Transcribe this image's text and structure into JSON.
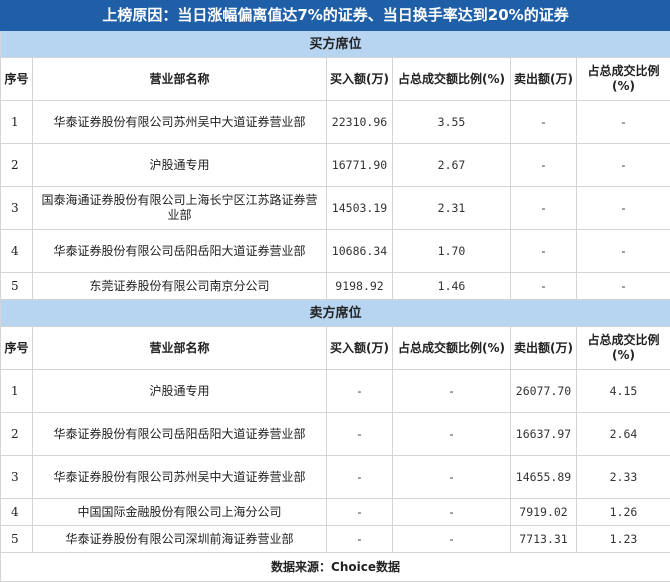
{
  "title": "上榜原因：当日涨幅偏离值达7%的证券、当日换手率达到20%的证券",
  "headers": [
    "序号",
    "营业部名称",
    "买入额(万)",
    "占总成交额比例(%)",
    "卖出额(万)",
    "占总成交比例(%)"
  ],
  "buy": {
    "section": "买方席位",
    "rows": [
      [
        "1",
        "华泰证券股份有限公司苏州吴中大道证券营业部",
        "22310.96",
        "3.55",
        "-",
        "-"
      ],
      [
        "2",
        "沪股通专用",
        "16771.90",
        "2.67",
        "-",
        "-"
      ],
      [
        "3",
        "国泰海通证券股份有限公司上海长宁区江苏路证券营业部",
        "14503.19",
        "2.31",
        "-",
        "-"
      ],
      [
        "4",
        "华泰证券股份有限公司岳阳岳阳大道证券营业部",
        "10686.34",
        "1.70",
        "-",
        "-"
      ],
      [
        "5",
        "东莞证券股份有限公司南京分公司",
        "9198.92",
        "1.46",
        "-",
        "-"
      ]
    ]
  },
  "sell": {
    "section": "卖方席位",
    "rows": [
      [
        "1",
        "沪股通专用",
        "-",
        "-",
        "26077.70",
        "4.15"
      ],
      [
        "2",
        "华泰证券股份有限公司岳阳岳阳大道证券营业部",
        "-",
        "-",
        "16637.97",
        "2.64"
      ],
      [
        "3",
        "华泰证券股份有限公司苏州吴中大道证券营业部",
        "-",
        "-",
        "14655.89",
        "2.33"
      ],
      [
        "4",
        "中国国际金融股份有限公司上海分公司",
        "-",
        "-",
        "7919.02",
        "1.26"
      ],
      [
        "5",
        "华泰证券股份有限公司深圳前海证券营业部",
        "-",
        "-",
        "7713.31",
        "1.23"
      ]
    ]
  },
  "footer": "数据来源：Choice数据"
}
